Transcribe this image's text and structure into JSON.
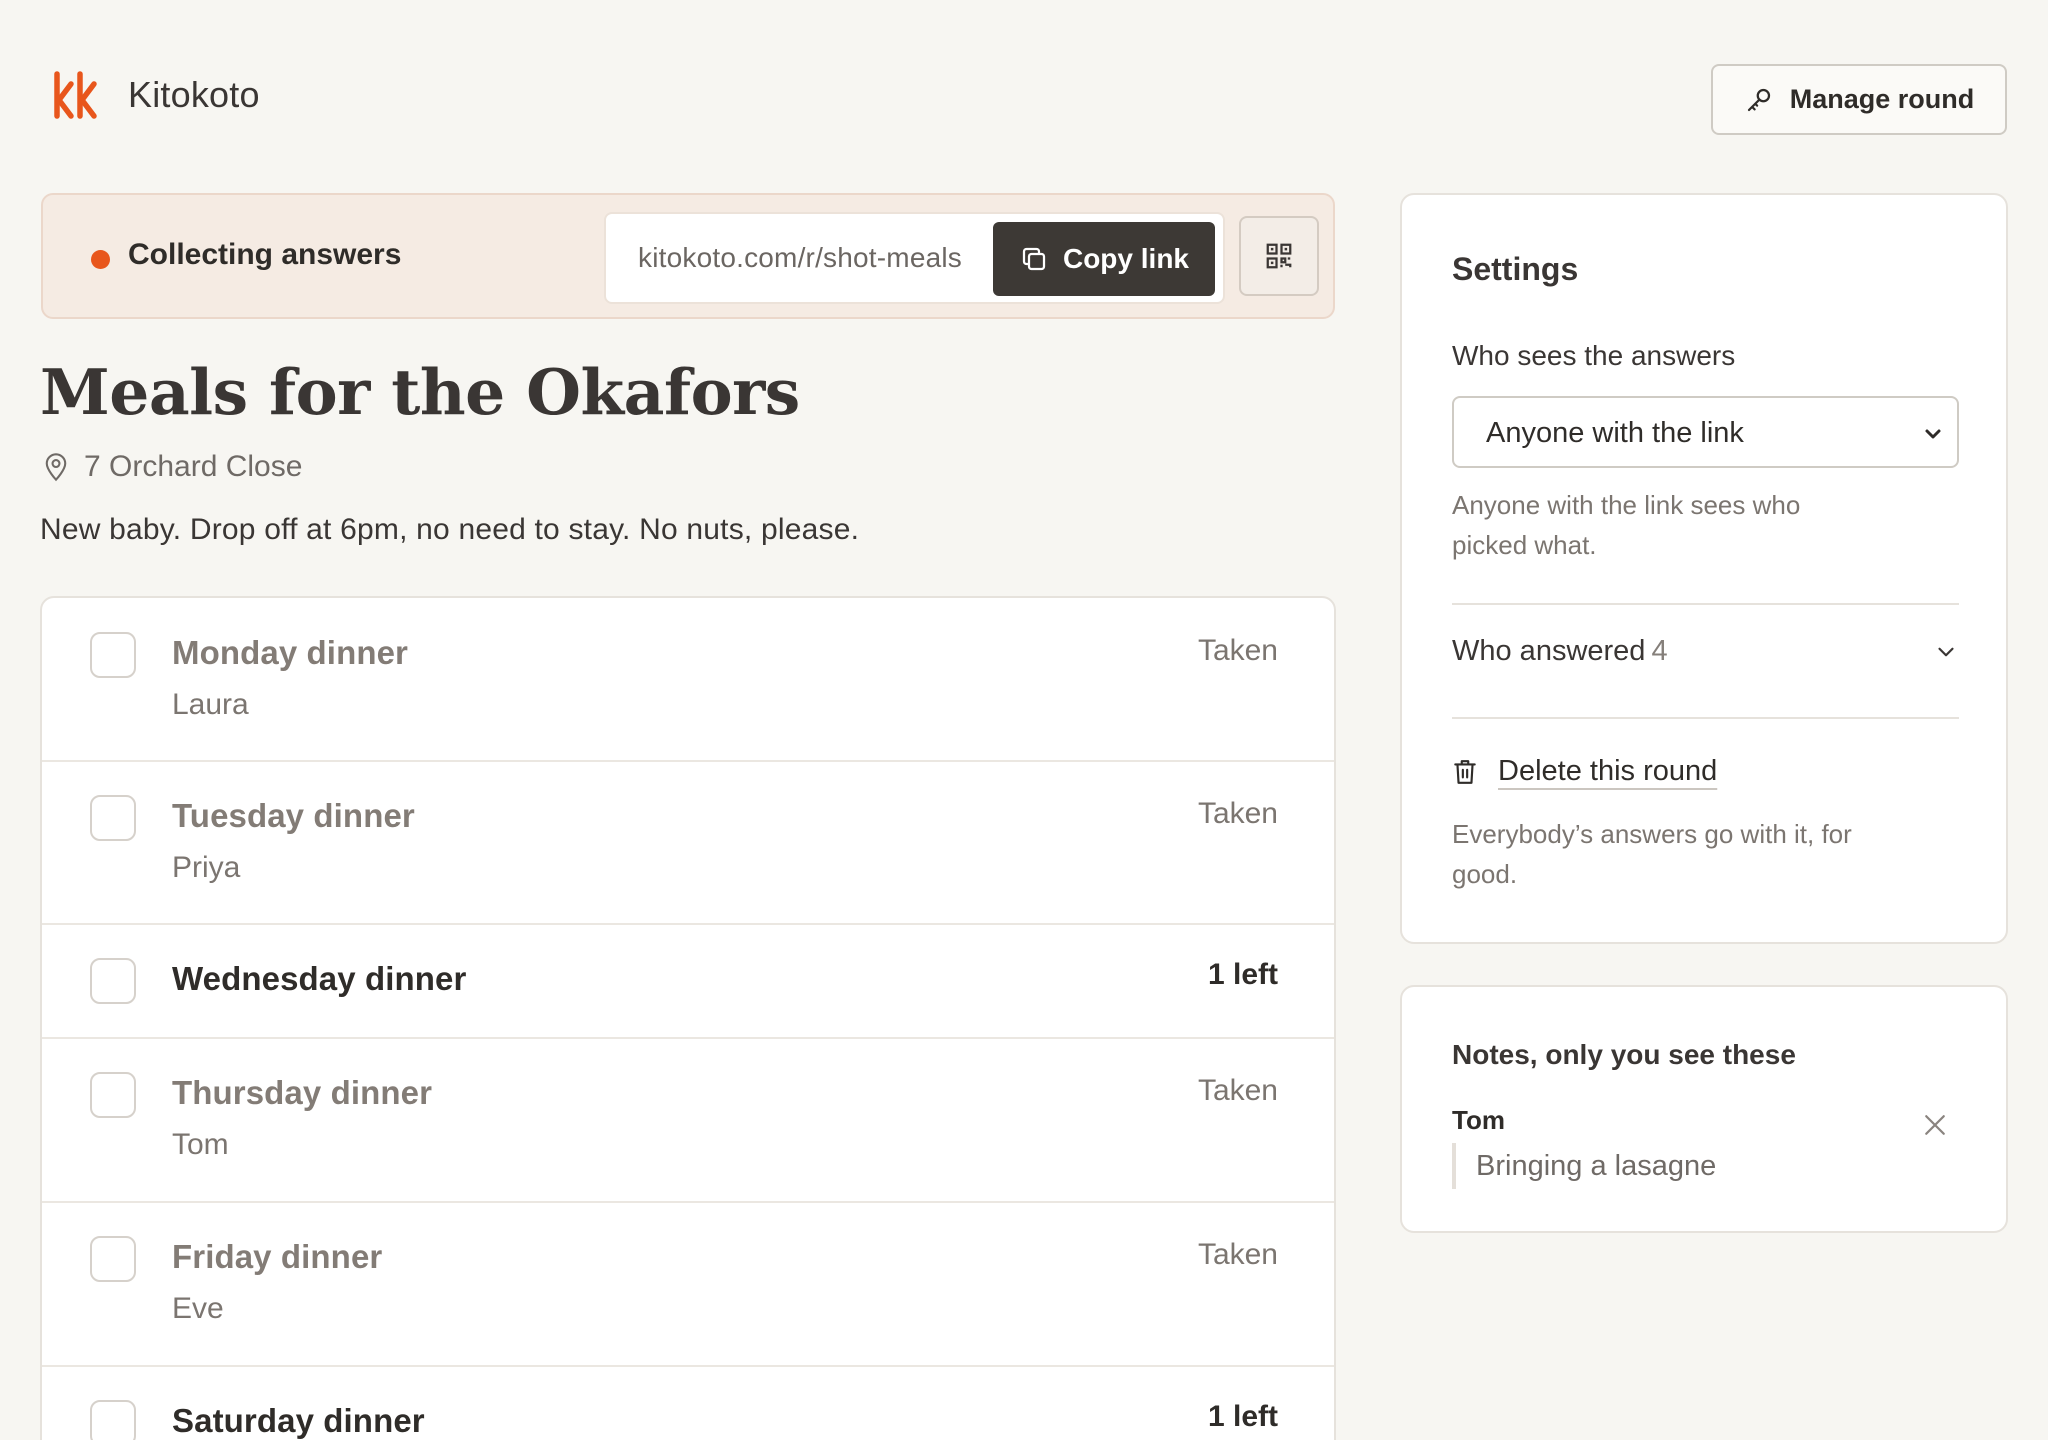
{
  "brand": {
    "name": "Kitokoto",
    "logo_icon": "kk-logo-icon",
    "accent": "#e8561c"
  },
  "header": {
    "manage_label": "Manage round",
    "manage_icon": "key-icon"
  },
  "status": {
    "text": "Collecting answers",
    "dot_color": "#e8561c",
    "link_url": "kitokoto.com/r/shot-meals",
    "copy_label": "Copy link",
    "copy_icon": "copy-icon",
    "qr_icon": "qr-code-icon"
  },
  "round": {
    "title": "Meals for the Okafors",
    "location": "7 Orchard Close",
    "location_icon": "map-pin-icon",
    "note": "New baby. Drop off at 6pm, no need to stay. No nuts, please."
  },
  "meals": [
    {
      "name": "Monday dinner",
      "person": "Laura",
      "status": "Taken",
      "open": false
    },
    {
      "name": "Tuesday dinner",
      "person": "Priya",
      "status": "Taken",
      "open": false
    },
    {
      "name": "Wednesday dinner",
      "person": "",
      "status": "1 left",
      "open": true
    },
    {
      "name": "Thursday dinner",
      "person": "Tom",
      "status": "Taken",
      "open": false
    },
    {
      "name": "Friday dinner",
      "person": "Eve",
      "status": "Taken",
      "open": false
    },
    {
      "name": "Saturday dinner",
      "person": "",
      "status": "1 left",
      "open": true
    }
  ],
  "settings": {
    "title": "Settings",
    "who_sees_label": "Who sees the answers",
    "visibility_value": "Anyone with the link",
    "visibility_help": "Anyone with the link sees who picked what.",
    "who_answered_label": "Who answered",
    "who_answered_count": "4",
    "delete_label": "Delete this round",
    "delete_help": "Everybody’s answers go with it, for good."
  },
  "notes": {
    "title": "Notes, only you see these",
    "items": [
      {
        "author": "Tom",
        "text": "Bringing a lasagne"
      }
    ]
  }
}
